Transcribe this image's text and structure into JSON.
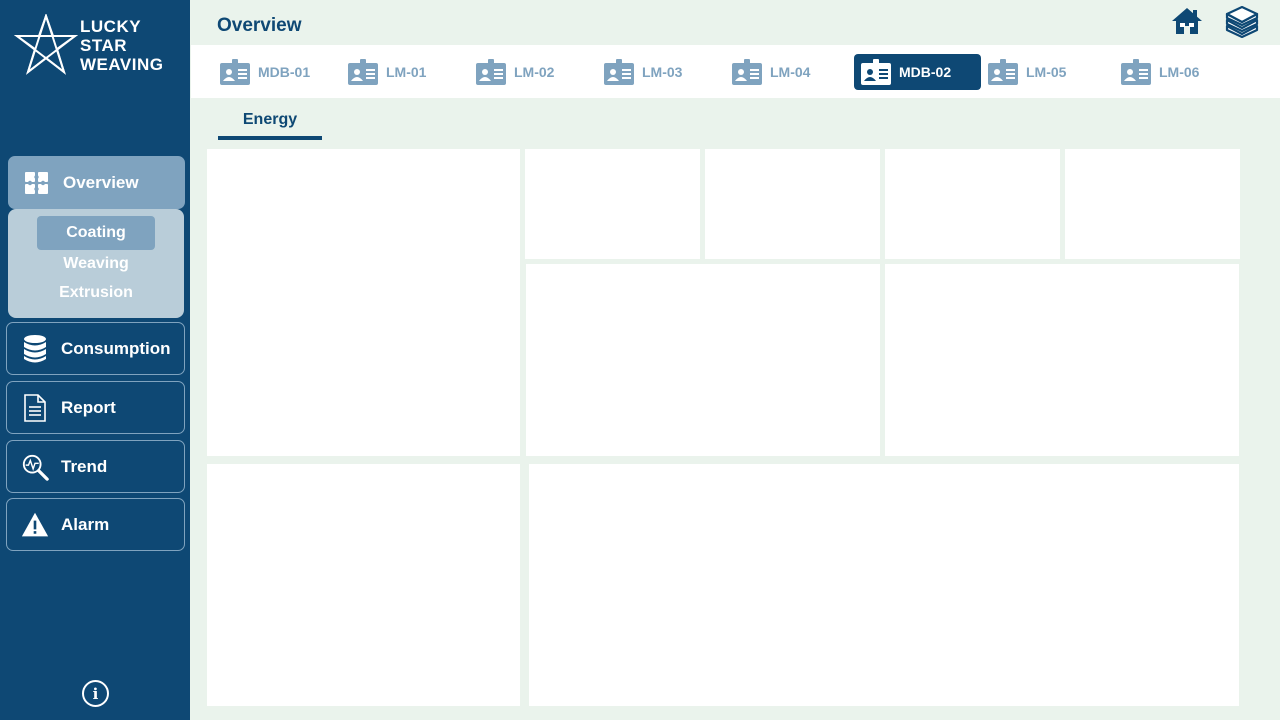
{
  "brand": {
    "line1": "LUCKY",
    "line2": "STAR",
    "line3": "WEAVING"
  },
  "header": {
    "title": "Overview",
    "home_icon": "home-icon",
    "layers_icon": "layers-icon"
  },
  "devices": [
    {
      "label": "MDB-01",
      "selected": false
    },
    {
      "label": "LM-01",
      "selected": false
    },
    {
      "label": "LM-02",
      "selected": false
    },
    {
      "label": "LM-03",
      "selected": false
    },
    {
      "label": "LM-04",
      "selected": false
    },
    {
      "label": "MDB-02",
      "selected": true
    },
    {
      "label": "LM-05",
      "selected": false
    },
    {
      "label": "LM-06",
      "selected": false
    }
  ],
  "content_tabs": [
    {
      "label": "Energy",
      "selected": true
    }
  ],
  "sidebar": {
    "overview": {
      "label": "Overview",
      "icon": "puzzle-icon"
    },
    "submenu": [
      {
        "label": "Coating",
        "selected": true
      },
      {
        "label": "Weaving",
        "selected": false
      },
      {
        "label": "Extrusion",
        "selected": false
      }
    ],
    "items": [
      {
        "label": "Consumption",
        "icon": "database-icon"
      },
      {
        "label": "Report",
        "icon": "document-icon"
      },
      {
        "label": "Trend",
        "icon": "trend-search-icon"
      },
      {
        "label": "Alarm",
        "icon": "warning-icon"
      }
    ],
    "info_icon": "i"
  },
  "colors": {
    "primary": "#0e4874",
    "accent_muted": "#7fa3bf",
    "submenu_bg": "#b9cdd9",
    "background": "#eaf3ec",
    "panel": "#ffffff"
  }
}
